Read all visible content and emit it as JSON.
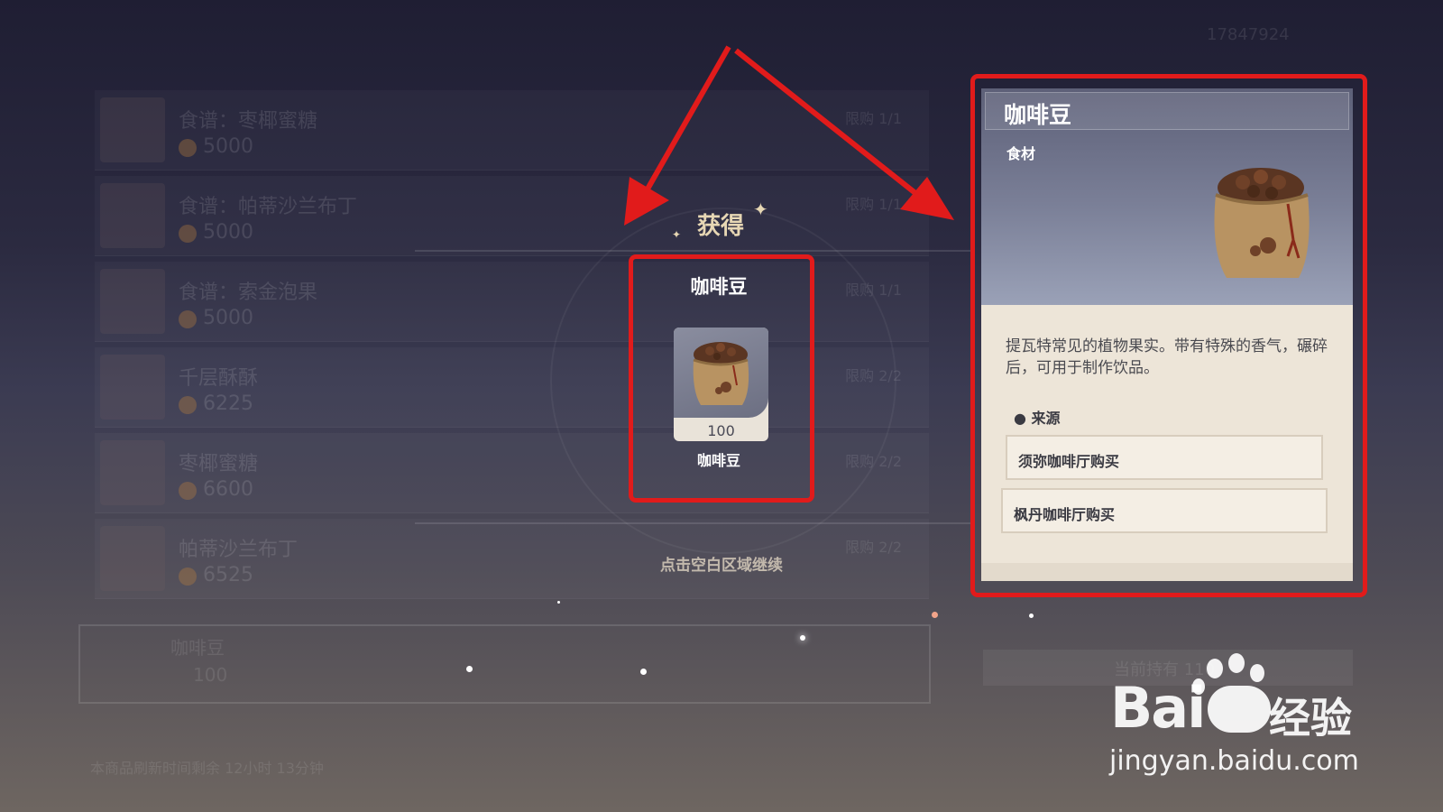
{
  "obtain": {
    "title": "获得",
    "item_name": "咖啡豆",
    "count": "100",
    "caption": "咖啡豆",
    "continue_hint": "点击空白区域继续"
  },
  "detail": {
    "title": "咖啡豆",
    "type": "食材",
    "description": "提瓦特常见的植物果实。带有特殊的香气，碾碎后，可用于制作饮品。",
    "source_label": "来源",
    "sources": [
      "须弥咖啡厅购买",
      "枫丹咖啡厅购买"
    ]
  },
  "background_shop": {
    "items": [
      {
        "name": "食谱：枣椰蜜糖",
        "price": "5000",
        "limit": "限购 1/1"
      },
      {
        "name": "食谱：帕蒂沙兰布丁",
        "price": "5000",
        "limit": "限购 1/1"
      },
      {
        "name": "食谱：索金泡果",
        "price": "5000",
        "limit": "限购 1/1"
      },
      {
        "name": "千层酥酥",
        "price": "6225",
        "limit": "限购 2/2"
      },
      {
        "name": "枣椰蜜糖",
        "price": "6600",
        "limit": "限购 2/2"
      },
      {
        "name": "帕蒂沙兰布丁",
        "price": "6525",
        "limit": "限购 2/2"
      }
    ],
    "selected_name": "咖啡豆",
    "selected_price": "100",
    "refresh_text": "本商品刷新时间剩余 12小时 13分钟",
    "owned_text": "当前持有 110",
    "currency": "17847924"
  },
  "watermark": {
    "logo": "Bai",
    "logo_cn": "经验",
    "url": "jingyan.baidu.com"
  },
  "colors": {
    "annotation_red": "#e11b1b",
    "gold_text": "#e7d7b4",
    "panel_bg": "#ede5d8"
  }
}
